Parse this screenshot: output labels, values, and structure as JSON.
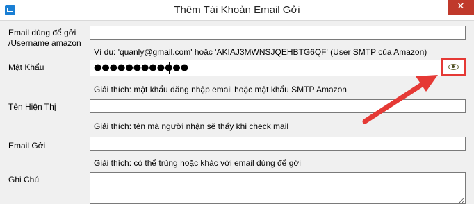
{
  "window": {
    "title": "Thêm Tài Khoản Email Gởi",
    "close_glyph": "✕",
    "app_icon": "mail-icon"
  },
  "form": {
    "email_label_line1": "Email dùng để gởi",
    "email_label_line2": "/Username amazon",
    "email_value": "",
    "email_hint": "Ví dụ: 'quanly@gmail.com' hoặc 'AKIAJ3MWNSJQEHBTG6QF' (User SMTP của Amazon)",
    "password_label": "Mật Khẩu",
    "password_value": "●●●●●●●●●●●●",
    "password_hint": "Giải thích: mật khẩu đăng nhập email hoặc mật khẩu SMTP Amazon",
    "show_password_icon": "eye-icon",
    "display_name_label": "Tên Hiện Thị",
    "display_name_value": "",
    "display_name_hint": "Giải thích: tên mà người nhận sẽ thấy khi check mail",
    "sender_email_label": "Email Gởi",
    "sender_email_value": "",
    "sender_email_hint": "Giải thích: có thể trùng hoặc khác với email dùng để gởi",
    "notes_label": "Ghi Chú",
    "notes_value": ""
  },
  "annotation": {
    "highlight_color": "#e53935",
    "arrow_color": "#e53935"
  }
}
